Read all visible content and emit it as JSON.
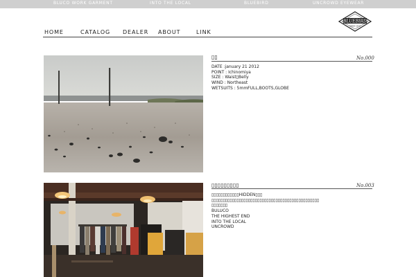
{
  "top_links": [
    "BLUCO WORK GARMENT",
    "INTO THE LOCAL",
    "BLUEBIRD",
    "UNCROWD EYEWEAR"
  ],
  "nav": [
    "HOME",
    "CATALOG",
    "DEALER",
    "ABOUT",
    "LINK"
  ],
  "logo": {
    "text": "BLUEBIRD",
    "subtext": "SINCE 1973"
  },
  "entries": [
    {
      "title": "▯▯",
      "number": "No.000",
      "lines": [
        "DATE :january 21 2012",
        "POINT : Ichinomiya",
        "SIZE : Waist▯Belly",
        "WIND : Northeast",
        "WETSUITS : 5mmFULL,BOOTS,GLOBE"
      ]
    },
    {
      "title": "▯▯▯▯▯▯▯▯▯",
      "number": "No.003",
      "lines": [
        "▯▯▯▯▯▯▯▯▯▯▯▯HIDDEN▯▯▯",
        "▯▯▯▯▯▯▯▯▯▯▯▯▯▯▯▯▯▯▯▯▯▯▯▯▯▯▯▯▯▯▯▯▯▯▯▯▯▯▯▯▯▯▯▯▯▯▯",
        "▯▯▯▯▯▯▯",
        "BULUCO",
        "THE HIGHEST END",
        "INTO THE LOCAL",
        "UNCROWD"
      ]
    }
  ]
}
